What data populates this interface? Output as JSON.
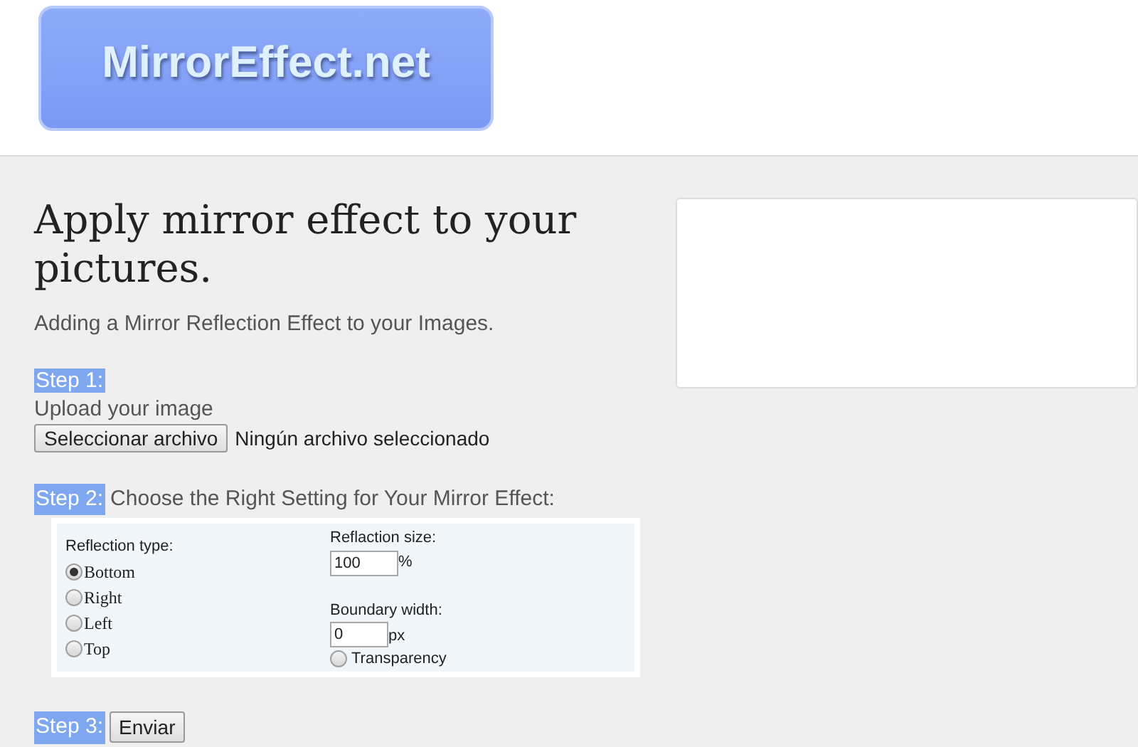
{
  "logo": {
    "text": "MirrorEffect.net"
  },
  "heading": "Apply mirror effect to your pictures.",
  "subtitle": "Adding a Mirror Reflection Effect to your Images.",
  "step1": {
    "label": "Step 1:",
    "text": "Upload your image",
    "button": "Seleccionar archivo",
    "file_status": "Ningún archivo seleccionado"
  },
  "step2": {
    "label": "Step 2:",
    "text": "Choose the Right Setting for Your Mirror Effect:",
    "reflection_type": {
      "label": "Reflection type:",
      "options": [
        {
          "label": "Bottom",
          "selected": true
        },
        {
          "label": "Right",
          "selected": false
        },
        {
          "label": "Left",
          "selected": false
        },
        {
          "label": "Top",
          "selected": false
        }
      ]
    },
    "size": {
      "label": "Reflaction size:",
      "value": "100",
      "unit": "%"
    },
    "boundary": {
      "label": "Boundary width:",
      "value": "0",
      "unit": "px"
    },
    "transparency": {
      "label": "Transparency",
      "selected": false
    }
  },
  "step3": {
    "label": "Step 3:",
    "button": "Enviar"
  }
}
